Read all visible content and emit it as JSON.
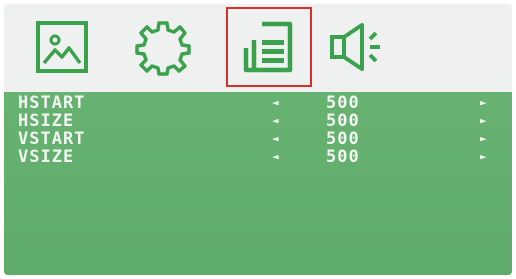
{
  "tabs": [
    {
      "icon": "picture-icon",
      "selected": false
    },
    {
      "icon": "gear-icon",
      "selected": false
    },
    {
      "icon": "osd-layout-icon",
      "selected": true
    },
    {
      "icon": "speaker-icon",
      "selected": false
    }
  ],
  "colors": {
    "icon_green": "#3aa14c",
    "selection_red": "#d9302c",
    "panel_green": "#63ae6e",
    "text": "#f2f7f2"
  },
  "menu": {
    "arrow_left": "◄",
    "arrow_right": "►",
    "items": [
      {
        "label": "HSTART",
        "value": "500"
      },
      {
        "label": "HSIZE",
        "value": "500"
      },
      {
        "label": "VSTART",
        "value": "500"
      },
      {
        "label": "VSIZE",
        "value": "500"
      }
    ]
  }
}
